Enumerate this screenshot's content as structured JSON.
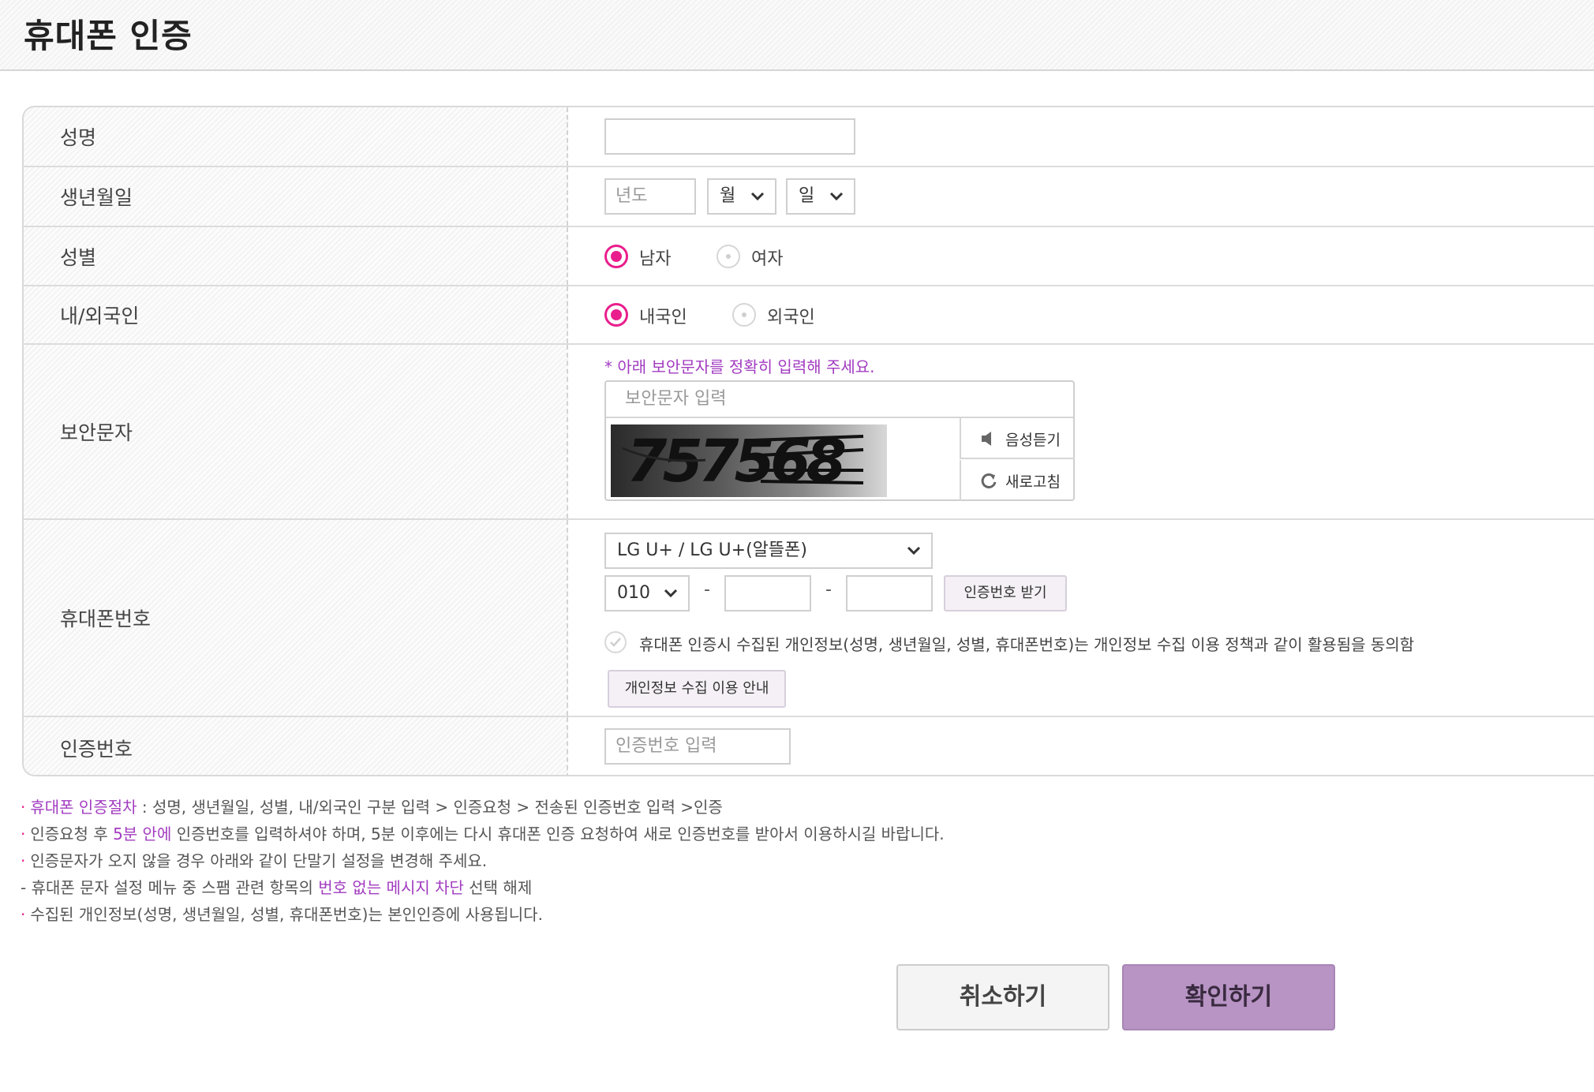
{
  "header": {
    "title": "휴대폰 인증"
  },
  "form": {
    "name": {
      "label": "성명",
      "value": ""
    },
    "birth": {
      "label": "생년월일",
      "year_placeholder": "년도",
      "month_value": "월",
      "day_value": "일"
    },
    "gender": {
      "label": "성별",
      "options": [
        "남자",
        "여자"
      ],
      "selected": "남자"
    },
    "nationality": {
      "label": "내/외국인",
      "options": [
        "내국인",
        "외국인"
      ],
      "selected": "내국인"
    },
    "captcha": {
      "label": "보안문자",
      "hint": "* 아래 보안문자를 정확히 입력해 주세요.",
      "placeholder": "보안문자 입력",
      "image_text": "757568",
      "listen_label": "음성듣기",
      "refresh_label": "새로고침"
    },
    "phone": {
      "label": "휴대폰번호",
      "carrier_value": "LG U+ / LG U+(알뜰폰)",
      "prefix_value": "010",
      "separator": "-",
      "request_button": "인증번호 받기",
      "agree_text": "휴대폰 인증시 수집된 개인정보(성명, 생년월일, 성별, 휴대폰번호)는 개인정보 수집 이용 정책과 같이 활용됨을 동의함",
      "privacy_button": "개인정보 수집 이용 안내"
    },
    "code": {
      "label": "인증번호",
      "placeholder": "인증번호 입력"
    }
  },
  "notes": {
    "n1_hl": "휴대폰 인증절차",
    "n1_rest": " : 성명, 생년월일, 성별, 내/외국인 구분 입력 > 인증요청 > 전송된 인증번호 입력 >인증",
    "n2_a": "인증요청 후 ",
    "n2_hl": "5분 안에",
    "n2_b": " 인증번호를 입력하셔야 하며, 5분 이후에는 다시 휴대폰 인증 요청하여 새로 인증번호를 받아서 이용하시길 바랍니다.",
    "n3": "인증문자가 오지 않을 경우 아래와 같이 단말기 설정을 변경해 주세요.",
    "n4_a": " - 휴대폰 문자 설정 메뉴 중 스팸 관련 항목의 ",
    "n4_hl": "번호 없는 메시지 차단",
    "n4_b": " 선택 해제",
    "n5": "수집된 개인정보(성명, 생년월일, 성별, 휴대폰번호)는 본인인증에 사용됩니다.",
    "bullet": "·"
  },
  "buttons": {
    "cancel": "취소하기",
    "confirm": "확인하기"
  },
  "colors": {
    "accent": "#e91e8c",
    "purple": "#a23cc0",
    "confirm_bg": "#b794c4"
  }
}
